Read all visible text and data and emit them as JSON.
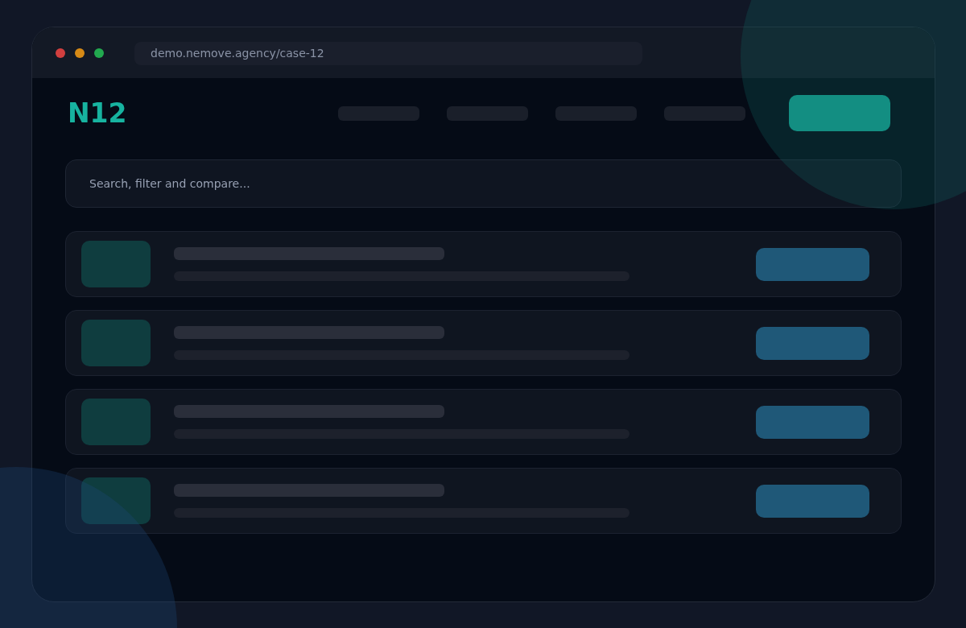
{
  "browser": {
    "url": "demo.nemove.agency/case-12",
    "dots": [
      {
        "color": "#d13f3f"
      },
      {
        "color": "#d68a16"
      },
      {
        "color": "#22a94f"
      }
    ]
  },
  "header": {
    "logo": "N12",
    "nav": [
      {
        "kind": "skeleton"
      },
      {
        "kind": "skeleton"
      },
      {
        "kind": "skeleton"
      },
      {
        "kind": "skeleton"
      }
    ],
    "cta": {
      "kind": "skeleton"
    }
  },
  "search": {
    "placeholder": "Search, filter and compare..."
  },
  "rows": [
    {
      "kind": "skeleton"
    },
    {
      "kind": "skeleton"
    },
    {
      "kind": "skeleton"
    },
    {
      "kind": "skeleton"
    }
  ]
}
